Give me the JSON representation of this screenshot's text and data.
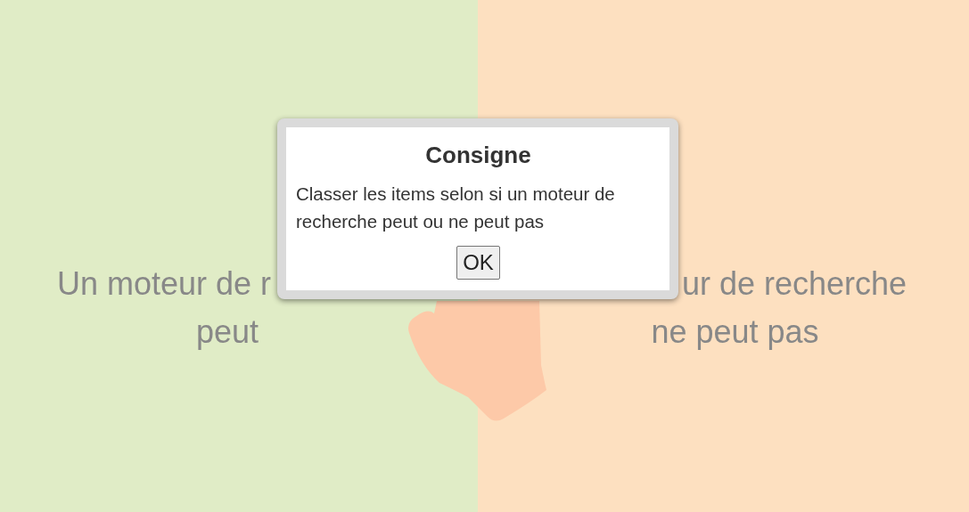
{
  "columns": [
    {
      "lines": [
        "Un moteur de r",
        "peut"
      ],
      "color": "#e0ecc6"
    },
    {
      "lines": [
        "ur de recherche",
        "ne peut pas"
      ],
      "color": "#fde0c0"
    }
  ],
  "dialog": {
    "title": "Consigne",
    "message": "Classer les items selon si un moteur de recherche peut ou ne peut pas",
    "buttons": [
      "OK"
    ]
  }
}
